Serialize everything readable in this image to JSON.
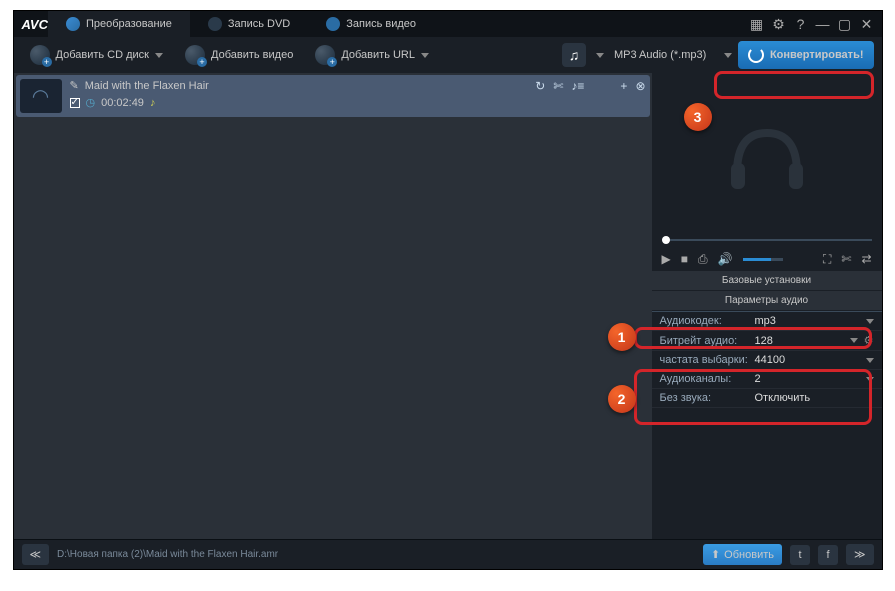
{
  "app": {
    "logo": "AVC"
  },
  "tabs": {
    "convert": "Преобразование",
    "dvd": "Запись DVD",
    "rec": "Запись видео"
  },
  "win": {
    "settings": "▦",
    "gear": "⚙",
    "help": "?",
    "min": "—",
    "max": "▢",
    "close": "✕"
  },
  "toolbar": {
    "add_cd": "Добавить CD диск",
    "add_video": "Добавить видео",
    "add_url": "Добавить URL"
  },
  "format": {
    "icon": "♫",
    "selected": "MP3 Audio (*.mp3)"
  },
  "convert": {
    "label": "Конвертировать!"
  },
  "item": {
    "title": "Maid with the Flaxen Hair",
    "duration": "00:02:49",
    "edit": "✎",
    "refresh": "↻",
    "cut": "✄",
    "note": "♪≡",
    "add": "+",
    "close": "⊗",
    "clock": "◷",
    "music": "♪"
  },
  "player": {
    "play": "▶",
    "stop": "■",
    "cam": "⎙",
    "vol": "🔊",
    "full": "⛶",
    "cut": "✄",
    "loop": "⇄"
  },
  "sections": {
    "basic": "Базовые установки",
    "audio": "Параметры аудио"
  },
  "params": {
    "codec": {
      "label": "Аудиокодек:",
      "value": "mp3"
    },
    "bitrate": {
      "label": "Битрейт аудио:",
      "value": "128"
    },
    "sample": {
      "label": "частата выбарки:",
      "value": "44100"
    },
    "channels": {
      "label": "Аудиоканалы:",
      "value": "2"
    },
    "mute": {
      "label": "Без звука:",
      "value": "Отключить"
    }
  },
  "footer": {
    "collapse": "≪",
    "path": "D:\\Новая папка (2)\\Maid with the Flaxen Hair.amr",
    "update": "Обновить",
    "expand": "≫"
  },
  "badges": {
    "b1": "1",
    "b2": "2",
    "b3": "3"
  }
}
